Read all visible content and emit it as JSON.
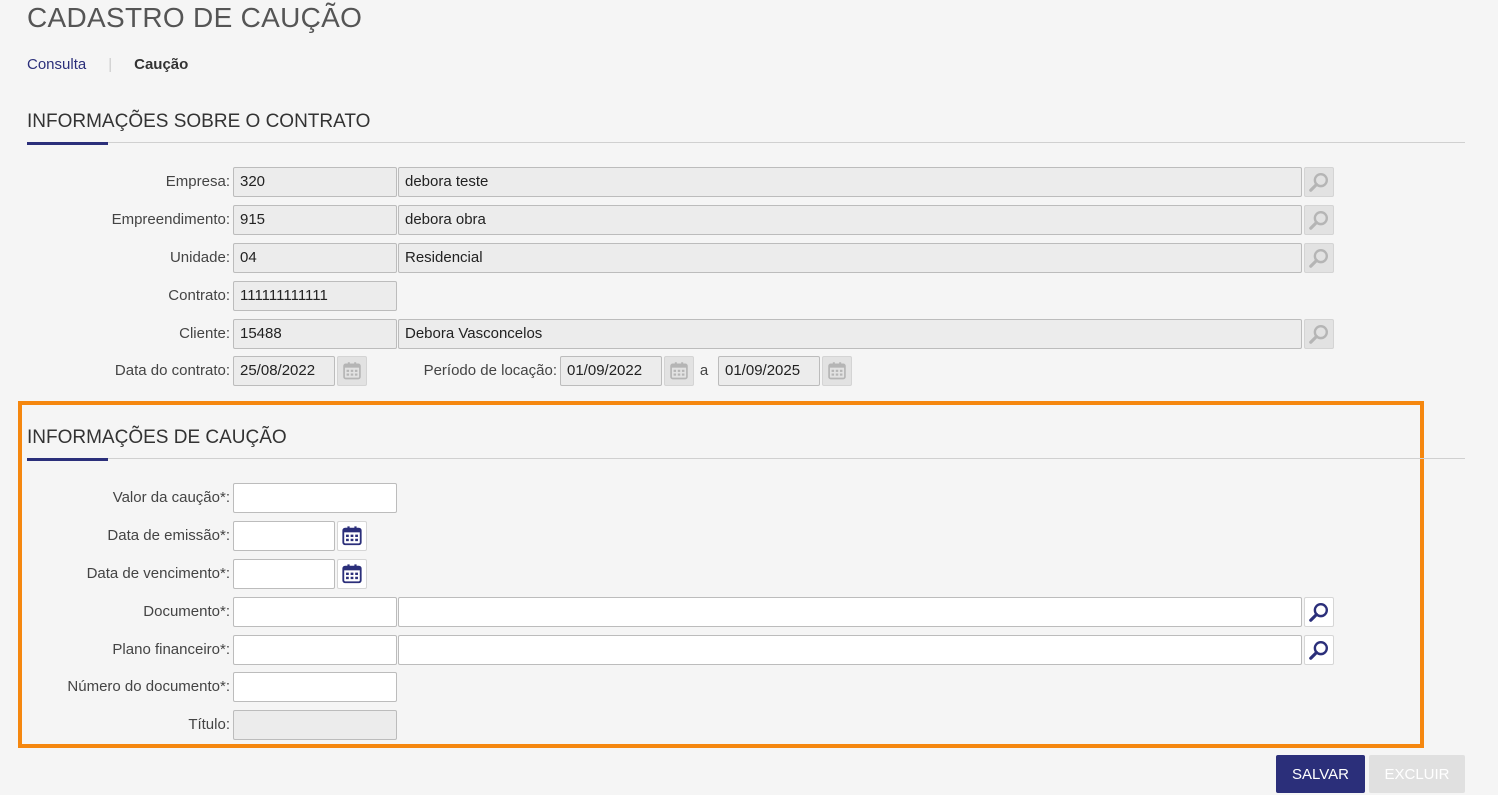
{
  "page": {
    "title": "CADASTRO DE CAUÇÃO"
  },
  "tabs": {
    "consult": "Consulta",
    "separator": "|",
    "active": "Caução"
  },
  "contract_section": {
    "title": "INFORMAÇÕES SOBRE O CONTRATO",
    "empresa": {
      "label": "Empresa:",
      "code": "320",
      "name": "debora teste"
    },
    "empreendimento": {
      "label": "Empreendimento:",
      "code": "915",
      "name": "debora obra"
    },
    "unidade": {
      "label": "Unidade:",
      "code": "04",
      "name": "Residencial"
    },
    "contrato": {
      "label": "Contrato:",
      "value": "111111111111"
    },
    "cliente": {
      "label": "Cliente:",
      "code": "15488",
      "name": "Debora Vasconcelos"
    },
    "data_contrato": {
      "label": "Data do contrato:",
      "value": "25/08/2022"
    },
    "periodo": {
      "label": "Período de locação:",
      "start": "01/09/2022",
      "connector": "a",
      "end": "01/09/2025"
    }
  },
  "caucao_section": {
    "title": "INFORMAÇÕES DE CAUÇÃO",
    "valor": {
      "label": "Valor da caução*:",
      "value": ""
    },
    "emissao": {
      "label": "Data de emissão*:",
      "value": ""
    },
    "vencimento": {
      "label": "Data de vencimento*:",
      "value": ""
    },
    "documento": {
      "label": "Documento*:",
      "code": "",
      "name": ""
    },
    "plano": {
      "label": "Plano financeiro*:",
      "code": "",
      "name": ""
    },
    "numero": {
      "label": "Número do documento*:",
      "value": ""
    },
    "titulo": {
      "label": "Título:",
      "value": ""
    }
  },
  "buttons": {
    "save": "SALVAR",
    "delete": "EXCLUIR"
  },
  "icons": {
    "search": "search-icon",
    "calendar": "calendar-icon"
  },
  "colors": {
    "primary": "#2b2f7a",
    "highlight": "#f5870f",
    "disabled_icon": "#b5b5b5"
  }
}
